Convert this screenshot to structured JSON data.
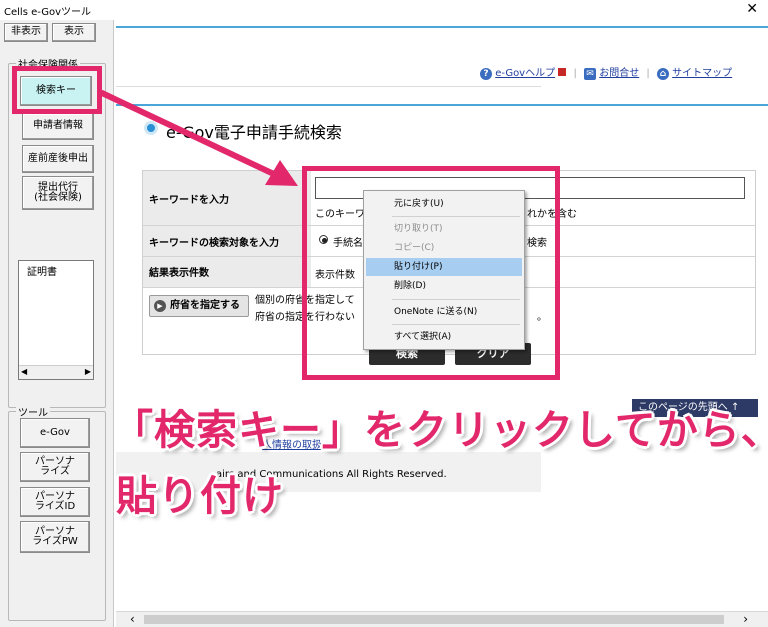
{
  "window": {
    "title": "Cells e-Govツール",
    "close_symbol": "✕"
  },
  "left": {
    "hide_label": "非表示",
    "show_label": "表示",
    "social_group_label": "社会保険関係",
    "buttons": [
      "検索キー",
      "申請者情報",
      "産前産後申出",
      "提出代行\n(社会保険)"
    ],
    "cert_list_item": "証明書",
    "tools_group_label": "ツール",
    "tool_buttons": [
      "e-Gov",
      "パーソナ\nライズ",
      "パーソナ\nライズID",
      "パーソナ\nライズPW"
    ]
  },
  "page": {
    "help_link": "e-Govヘルプ",
    "contact_link": "お問合せ",
    "sitemap_link": "サイトマップ",
    "heading": "e-Gov電子申請手続検索",
    "row1_label": "キーワードを入力",
    "row1_hint_left": "このキーワ",
    "row1_hint_right": "れかを含む",
    "row2_label": "キーワードの検索対象を入力",
    "row2_option": "手続名",
    "row2_right": "検索",
    "row3_label": "結果表示件数",
    "row3_value": "表示件数",
    "pref_button": "府省を指定する",
    "pref_text1": "個別の府省を指定して",
    "pref_text2": "府省の指定を行わない",
    "pref_text_end": "。",
    "search_button": "検索",
    "clear_button": "クリア",
    "back_to_top": "このページの先頭へ",
    "privacy_link": "人情報の取扱",
    "copyright": "airs and Communications All Rights Reserved."
  },
  "context_menu": {
    "items": [
      {
        "label": "元に戻す(U)",
        "disabled": false
      },
      {
        "label": "切り取り(T)",
        "disabled": true
      },
      {
        "label": "コピー(C)",
        "disabled": true
      },
      {
        "label": "貼り付け(P)",
        "disabled": false,
        "highlighted": true
      },
      {
        "label": "削除(D)",
        "disabled": false
      },
      {
        "label": "OneNote に送る(N)",
        "disabled": false
      },
      {
        "label": "すべて選択(A)",
        "disabled": false
      }
    ]
  },
  "annotation": {
    "line1": "「検索キー」をクリックしてから、",
    "line2": "貼り付け",
    "accent_color": "#e2286b"
  }
}
